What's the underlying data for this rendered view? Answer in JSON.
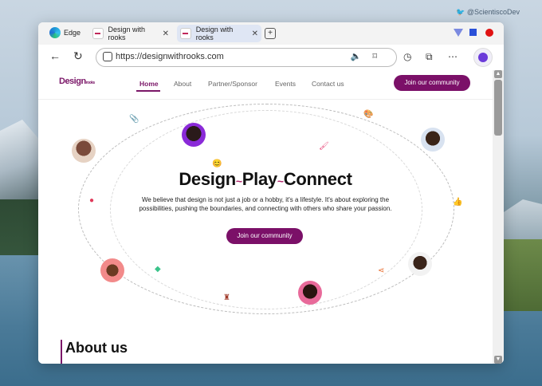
{
  "credit": "@ScientiscoDev",
  "browser": {
    "name": "Edge",
    "tabs": [
      {
        "label": "Design with rooks",
        "active": false
      },
      {
        "label": "Design with rooks",
        "active": true
      }
    ],
    "url": "https://designwithrooks.com"
  },
  "site": {
    "logo": "Design",
    "logo_sub": "rooks",
    "nav": [
      "Home",
      "About",
      "Partner/Sponsor",
      "Events",
      "Contact us"
    ],
    "cta_top": "Join our community",
    "hero": {
      "title_parts": [
        "Design",
        "Play",
        "Connect"
      ],
      "separator": "~",
      "text": "We believe that design is not just a job or a hobby, it's a lifestyle. It's about exploring the possibilities, pushing the boundaries, and connecting with others who share your passion.",
      "cta": "Join our community"
    },
    "about_heading": "About us"
  },
  "colors": {
    "brand": "#7b1068",
    "accent": "#b0246a"
  }
}
